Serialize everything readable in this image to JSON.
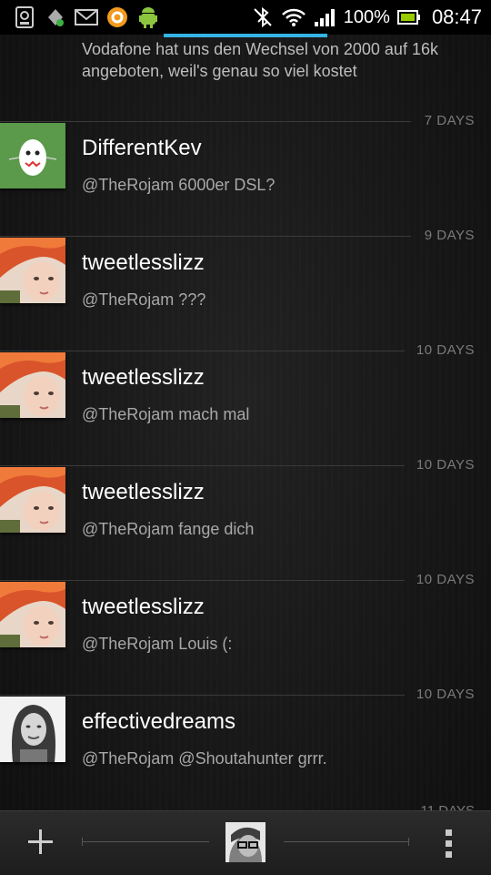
{
  "status_bar": {
    "battery_percent": "100%",
    "time": "08:47"
  },
  "timeline": {
    "partial_tweet_text": "Vodafone hat uns den Wechsel von 2000 auf 16k angeboten, weil's genau so viel kostet",
    "tweets": [
      {
        "age": "7 DAYS",
        "name": "DifferentKev",
        "text": "@TheRojam 6000er DSL?",
        "avatar": "egg-avatar"
      },
      {
        "age": "9 DAYS",
        "name": "tweetlesslizz",
        "text": "@TheRojam ???",
        "avatar": "redhead-avatar"
      },
      {
        "age": "10 DAYS",
        "name": "tweetlesslizz",
        "text": "@TheRojam mach mal",
        "avatar": "redhead-avatar"
      },
      {
        "age": "10 DAYS",
        "name": "tweetlesslizz",
        "text": "@TheRojam fange dich",
        "avatar": "redhead-avatar"
      },
      {
        "age": "10 DAYS",
        "name": "tweetlesslizz",
        "text": "@TheRojam Louis (:",
        "avatar": "redhead-avatar"
      },
      {
        "age": "10 DAYS",
        "name": "effectivedreams",
        "text": "@TheRojam @Shoutahunter grrr.",
        "avatar": "grayscale-avatar"
      }
    ],
    "next_age_partial": "11 DAYS"
  },
  "bottom_bar": {
    "compose_icon": "plus-icon",
    "account_icon": "account-avatar",
    "menu_icon": "overflow-menu-icon"
  },
  "colors": {
    "accent": "#35b3e5",
    "background": "#151515",
    "separator": "#3a3a3a",
    "egg_background": "#5a9a4a"
  }
}
